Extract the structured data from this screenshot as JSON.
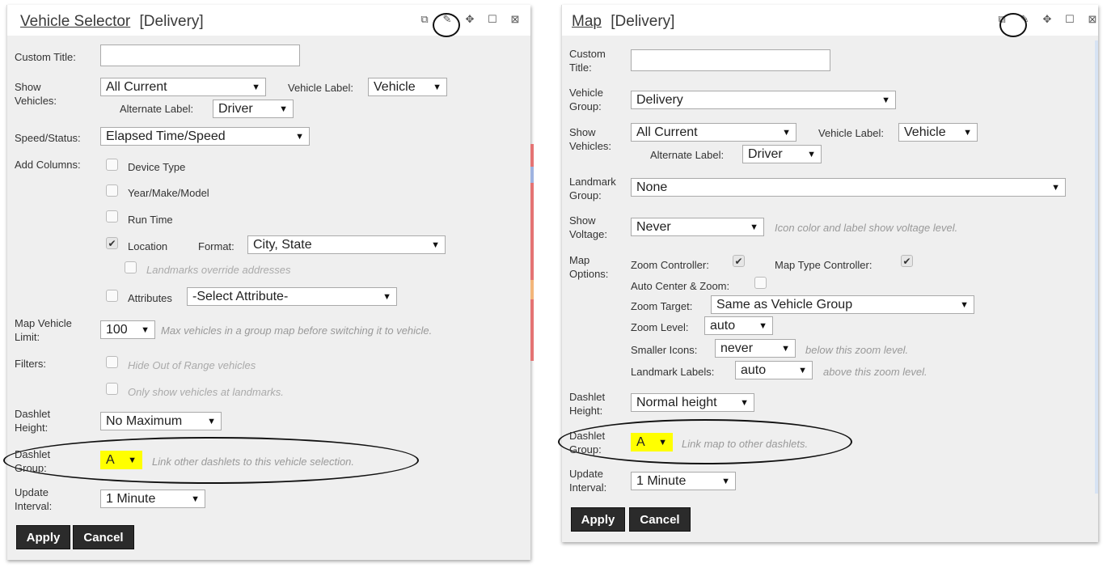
{
  "left": {
    "title_main": "Vehicle Selector",
    "title_sub": "[Delivery]",
    "custom_title_label": "Custom Title:",
    "show_vehicles_label": "Show Vehicles:",
    "show_vehicles_value": "All Current",
    "vehicle_label_label": "Vehicle Label:",
    "vehicle_label_value": "Vehicle",
    "alternate_label_label": "Alternate Label:",
    "alternate_label_value": "Driver",
    "speed_status_label": "Speed/Status:",
    "speed_status_value": "Elapsed Time/Speed",
    "add_columns_label": "Add Columns:",
    "col_device_type": "Device Type",
    "col_year_make_model": "Year/Make/Model",
    "col_run_time": "Run Time",
    "col_location": "Location",
    "format_label": "Format:",
    "format_value": "City, State",
    "landmarks_override": "Landmarks override addresses",
    "col_attributes": "Attributes",
    "attribute_value": "-Select Attribute-",
    "map_vehicle_limit_label": "Map Vehicle Limit:",
    "map_vehicle_limit_value": "100",
    "map_vehicle_limit_hint": "Max vehicles in a group map before switching it to vehicle.",
    "filters_label": "Filters:",
    "filter_out_of_range": "Hide Out of Range vehicles",
    "filter_landmarks": "Only show vehicles at landmarks.",
    "dashlet_height_label": "Dashlet Height:",
    "dashlet_height_value": "No Maximum",
    "dashlet_group_label": "Dashlet Group:",
    "dashlet_group_value": "A",
    "dashlet_group_hint": "Link other dashlets to this vehicle selection.",
    "update_interval_label": "Update Interval:",
    "update_interval_value": "1 Minute",
    "apply": "Apply",
    "cancel": "Cancel"
  },
  "right": {
    "title_main": "Map",
    "title_sub": "[Delivery]",
    "custom_title_label": "Custom Title:",
    "vehicle_group_label": "Vehicle Group:",
    "vehicle_group_value": "Delivery",
    "show_vehicles_label": "Show Vehicles:",
    "show_vehicles_value": "All Current",
    "vehicle_label_label": "Vehicle Label:",
    "vehicle_label_value": "Vehicle",
    "alternate_label_label": "Alternate Label:",
    "alternate_label_value": "Driver",
    "landmark_group_label": "Landmark Group:",
    "landmark_group_value": "None",
    "show_voltage_label": "Show Voltage:",
    "show_voltage_value": "Never",
    "show_voltage_hint": "Icon color and label show voltage level.",
    "map_options_label": "Map Options:",
    "zoom_controller_label": "Zoom Controller:",
    "map_type_controller_label": "Map Type Controller:",
    "auto_center_label": "Auto Center & Zoom:",
    "zoom_target_label": "Zoom Target:",
    "zoom_target_value": "Same as Vehicle Group",
    "zoom_level_label": "Zoom Level:",
    "zoom_level_value": "auto",
    "smaller_icons_label": "Smaller Icons:",
    "smaller_icons_value": "never",
    "smaller_icons_hint": "below this zoom level.",
    "landmark_labels_label": "Landmark Labels:",
    "landmark_labels_value": "auto",
    "landmark_labels_hint": "above this zoom level.",
    "dashlet_height_label": "Dashlet Height:",
    "dashlet_height_value": "Normal height",
    "dashlet_group_label": "Dashlet Group:",
    "dashlet_group_value": "A",
    "dashlet_group_hint": "Link map to other dashlets.",
    "update_interval_label": "Update Interval:",
    "update_interval_value": "1 Minute",
    "apply": "Apply",
    "cancel": "Cancel"
  },
  "icons": [
    "copy-icon",
    "edit-pencil-icon",
    "move-icon",
    "maximize-icon",
    "close-icon",
    "dropdown-arrow-icon",
    "checkmark-icon"
  ],
  "colors": {
    "highlight": "#ffff00",
    "button": "#2b2b2b",
    "panel": "#efefef",
    "hint": "#999999"
  }
}
